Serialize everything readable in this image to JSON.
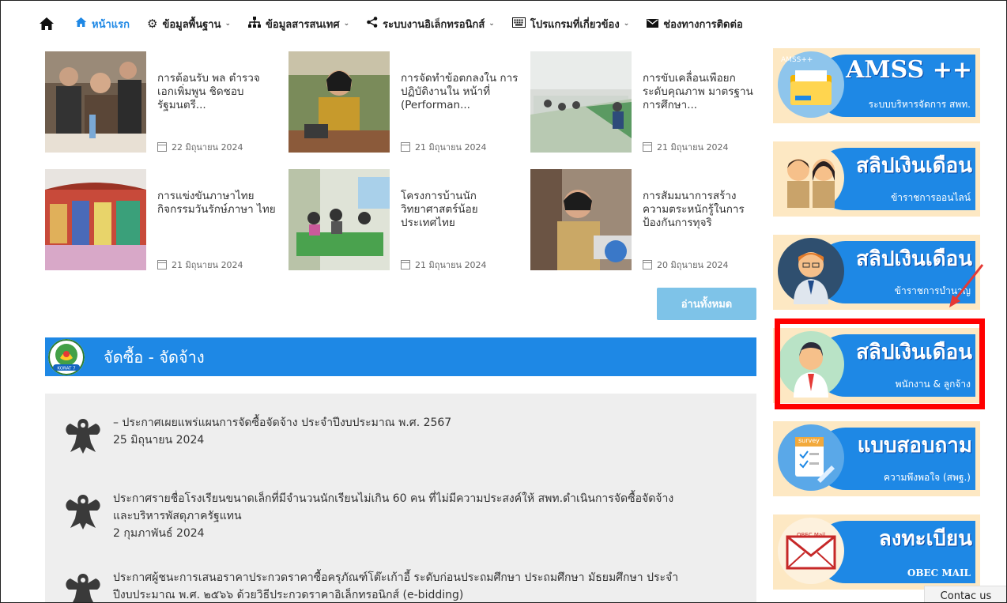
{
  "nav": {
    "items": [
      {
        "label": "หน้าแรก",
        "icon": "home-icon",
        "dropdown": false,
        "active": true
      },
      {
        "label": "ข้อมูลพื้นฐาน",
        "icon": "gear-icon",
        "dropdown": true
      },
      {
        "label": "ข้อมูลสารสนเทศ",
        "icon": "sitemap-icon",
        "dropdown": true
      },
      {
        "label": "ระบบงานอิเล็กทรอนิกส์",
        "icon": "share-icon",
        "dropdown": true
      },
      {
        "label": "โปรแกรมที่เกี่ยวข้อง",
        "icon": "keyboard-icon",
        "dropdown": true
      },
      {
        "label": "ช่องทางการติดต่อ",
        "icon": "envelope-icon",
        "dropdown": false
      }
    ],
    "chevron": "⌄"
  },
  "news": [
    {
      "title": "การต้อนรับ พล ตำรวจเอกเพิ่มพูน ชิดชอบ รัฐมนตรี...",
      "date": "22 มิถุนายน 2024"
    },
    {
      "title": "การจัดทำข้อตกลงใน การปฏิบัติงานใน หน้าที่ (Performan...",
      "date": "21 มิถุนายน 2024"
    },
    {
      "title": "การขับเคลื่อนเพือยก ระดับคุณภาพ มาตรฐานการศึกษา...",
      "date": "21 มิถุนายน 2024"
    },
    {
      "title": "การแข่งขันภาษาไทย กิจกรรมวันรักษ์ภาษา ไทย",
      "date": "21 มิถุนายน 2024"
    },
    {
      "title": "โครงการบ้านนัก วิทยาศาสตร์น้อย ประเทศไทย",
      "date": "21 มิถุนายน 2024"
    },
    {
      "title": "การสัมมนาการสร้าง ความตระหนักรู้ในการ ป้องกันการทุจริ",
      "date": "20 มิถุนายน 2024"
    }
  ],
  "read_all": "อ่านทั้งหมด",
  "procurement": {
    "title": "จัดซื้อ - จัดจ้าง",
    "logo_text": "KORAT 7",
    "items": [
      {
        "line1": "– ประกาศเผยแพร่แผนการจัดซื้อจัดจ้าง ประจำปีงบประมาณ พ.ศ. 2567",
        "line2": "",
        "date": "25 มิถุนายน 2024"
      },
      {
        "line1": "ประกาศรายชื่อโรงเรียนขนาดเล็กที่มีจำนวนนักเรียนไม่เกิน 60 คน ที่ไม่มีความประสงค์ให้ สพท.ดำเนินการจัดซื้อจัดจ้าง",
        "line2": "และบริหารพัสดุภาครัฐแทน",
        "date": "2 กุมภาพันธ์ 2024"
      },
      {
        "line1": "ประกาศผู้ชนะการเสนอราคาประกวดราคาซื้อครุภัณฑ์โต๊ะเก้าอี้ ระดับก่อนประถมศึกษา ประถมศึกษา มัธยมศึกษา ประจำ",
        "line2": "ปีงบประมาณ พ.ศ. ๒๕๖๖ ด้วยวิธีประกวดราคาอิเล็กทรอนิกส์ (e-bidding)",
        "date": ""
      }
    ]
  },
  "sidebar": {
    "banners": [
      {
        "big": "AMSS ++",
        "small": "ระบบบริหารจัดการ สพท.",
        "badge": "AMSS++",
        "icon": "folder-icon"
      },
      {
        "big": "สลิปเงินเดือน",
        "small": "ข้าราชการออนไลน์",
        "icon": "teachers-icon"
      },
      {
        "big": "สลิปเงินเดือน",
        "small": "ข้าราชการบำนาญ",
        "icon": "retired-officer-icon"
      },
      {
        "big": "สลิปเงินเดือน",
        "small": "พนักงาน & ลูกจ้าง",
        "icon": "employee-icon"
      },
      {
        "big": "แบบสอบถาม",
        "small": "ความพึงพอใจ (สพฐ.)",
        "badge": "survey",
        "icon": "survey-icon"
      },
      {
        "big": "ลงทะเบียน",
        "small": "OBEC MAIL",
        "badge": "OBEC Mail",
        "icon": "mail-icon"
      }
    ]
  },
  "contact_us": "Contac us",
  "colors": {
    "accent": "#1e88e5",
    "highlight": "#ff0000",
    "banner_bg": "#fde8c3"
  }
}
